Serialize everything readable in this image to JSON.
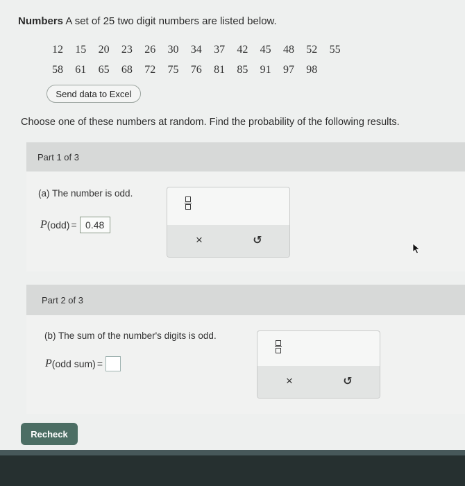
{
  "problem": {
    "title_bold": "Numbers",
    "title_rest": " A set of 25 two digit numbers are listed below.",
    "numbers_row1": [
      "12",
      "15",
      "20",
      "23",
      "26",
      "30",
      "34",
      "37",
      "42",
      "45",
      "48",
      "52",
      "55"
    ],
    "numbers_row2": [
      "58",
      "61",
      "65",
      "68",
      "72",
      "75",
      "76",
      "81",
      "85",
      "91",
      "97",
      "98"
    ],
    "excel_button": "Send data to Excel",
    "instruction": "Choose one of these numbers at random. Find the probability of the following results."
  },
  "part1": {
    "header": "Part 1 of 3",
    "question": "(a) The number is odd.",
    "expr_prefix": "P",
    "expr_arg": "(odd)",
    "equals": "=",
    "answer": "0.48"
  },
  "part2": {
    "header": "Part 2 of 3",
    "question": "(b) The sum of the number's digits is odd.",
    "expr_prefix": "P",
    "expr_arg": "(odd sum)",
    "equals": "=",
    "answer": ""
  },
  "tools": {
    "fraction_icon": "fraction-icon",
    "clear_icon": "×",
    "undo_icon": "↺"
  },
  "recheck_button": "Recheck"
}
